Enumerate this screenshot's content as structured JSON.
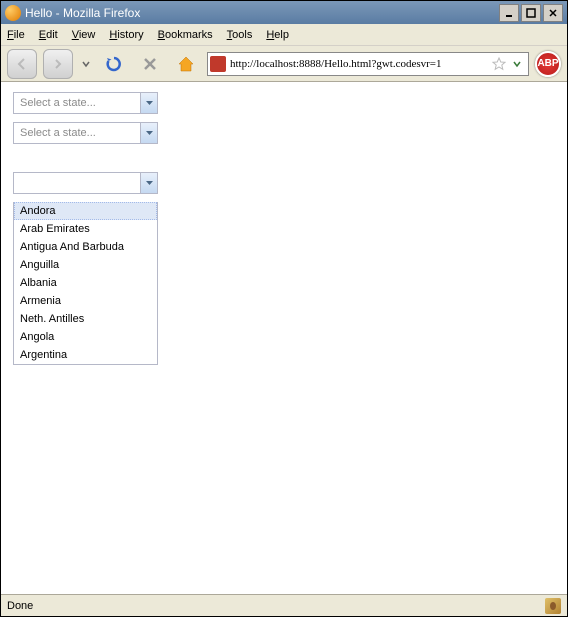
{
  "window": {
    "title": "Hello - Mozilla Firefox",
    "buttons": {
      "min": "_",
      "max": "□",
      "close": "×"
    }
  },
  "menu": {
    "file": "File",
    "edit": "Edit",
    "view": "View",
    "history": "History",
    "bookmarks": "Bookmarks",
    "tools": "Tools",
    "help": "Help"
  },
  "toolbar": {
    "url": "http://localhost:8888/Hello.html?gwt.codesvr=1",
    "abp": "ABP"
  },
  "combos": {
    "placeholder": "Select a state...",
    "open_value": "",
    "options": {
      "0": "Andora",
      "1": "Arab Emirates",
      "2": "Antigua And Barbuda",
      "3": "Anguilla",
      "4": "Albania",
      "5": "Armenia",
      "6": "Neth. Antilles",
      "7": "Angola",
      "8": "Argentina"
    }
  },
  "status": {
    "text": "Done"
  }
}
